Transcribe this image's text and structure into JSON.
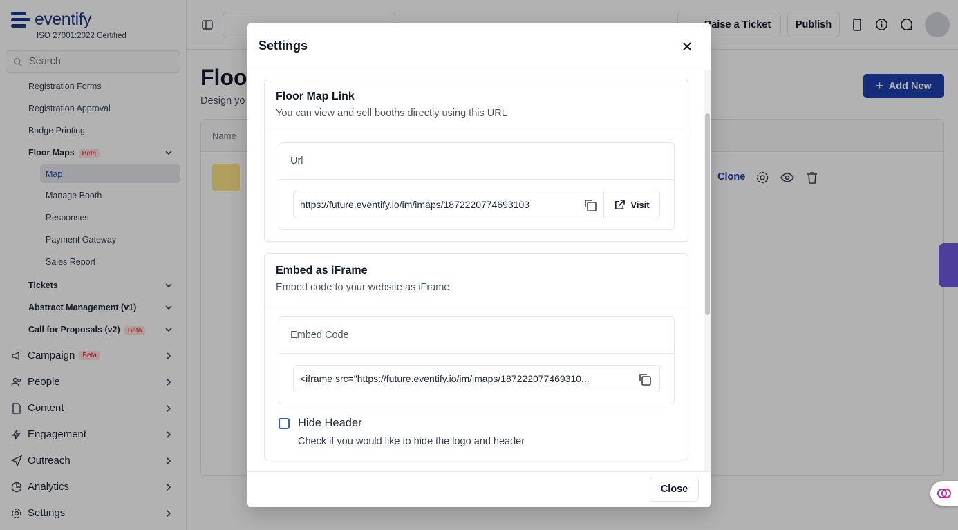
{
  "brand": {
    "name": "eventify",
    "cert": "ISO 27001:2022 Certified"
  },
  "search": {
    "placeholder": "Search"
  },
  "sidebar": {
    "sub_items": [
      "Registration Forms",
      "Registration Approval",
      "Badge Printing"
    ],
    "floor_maps": {
      "label": "Floor Maps",
      "badge": "Beta"
    },
    "floor_map_children": [
      "Map",
      "Manage Booth",
      "Responses",
      "Payment Gateway",
      "Sales Report"
    ],
    "groups": [
      {
        "label": "Tickets",
        "badge": ""
      },
      {
        "label": "Abstract Management (v1)",
        "badge": ""
      },
      {
        "label": "Call for Proposals (v2)",
        "badge": "Beta"
      }
    ],
    "main": [
      {
        "label": "Campaign",
        "badge": "Beta"
      },
      {
        "label": "People",
        "badge": ""
      },
      {
        "label": "Content",
        "badge": ""
      },
      {
        "label": "Engagement",
        "badge": ""
      },
      {
        "label": "Outreach",
        "badge": ""
      },
      {
        "label": "Analytics",
        "badge": ""
      },
      {
        "label": "Settings",
        "badge": ""
      }
    ]
  },
  "topbar": {
    "raise_ticket": "Raise a Ticket",
    "publish": "Publish"
  },
  "page": {
    "title": "Floor",
    "subtitle": "Design yo",
    "add_new": "Add New",
    "table": {
      "col_name": "Name",
      "clone": "Clone"
    }
  },
  "modal": {
    "title": "Settings",
    "close": "Close",
    "floor_map_link": {
      "title": "Floor Map Link",
      "description": "You can view and sell booths directly using this URL",
      "url_label": "Url",
      "url_value": "https://future.eventify.io/im/imaps/1872220774693103",
      "visit": "Visit"
    },
    "embed": {
      "title": "Embed as iFrame",
      "description": "Embed code to your website as iFrame",
      "code_label": "Embed Code",
      "code_value": "<iframe src=\"https://future.eventify.io/im/imaps/187222077469310...",
      "hide_header_label": "Hide Header",
      "hide_header_desc": "Check if you would like to hide the logo and header",
      "hide_header_checked": false
    }
  },
  "colors": {
    "brand": "#1e3a8a",
    "primary": "#1e40af",
    "beta_text": "#dc2626"
  }
}
